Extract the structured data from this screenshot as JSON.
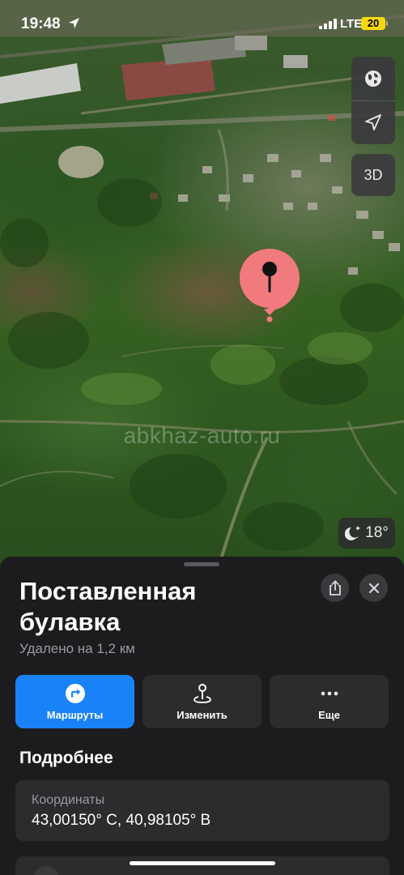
{
  "status_bar": {
    "time": "19:48",
    "network": "LTE",
    "battery": "20",
    "battery_color": "#f5d80a"
  },
  "map": {
    "watermark": "abkhaz-auto.ru",
    "controls": {
      "globe_icon": "globe-icon",
      "location_icon": "location-arrow-icon",
      "view_3d_label": "3D"
    },
    "weather": {
      "icon": "moon-stars-icon",
      "temperature": "18°"
    },
    "pin_color": "#f07a7e"
  },
  "sheet": {
    "title": "Поставленная булавка",
    "distance": "Удалено на 1,2 км",
    "actions": [
      {
        "label": "Маршруты",
        "icon": "directions-icon",
        "color": "#1a82f7"
      },
      {
        "label": "Изменить",
        "icon": "pin-edit-icon"
      },
      {
        "label": "Еще",
        "icon": "more-icon"
      }
    ],
    "details_title": "Подробнее",
    "coordinates": {
      "label": "Координаты",
      "value": "43,00150° С, 40,98105° В"
    }
  }
}
